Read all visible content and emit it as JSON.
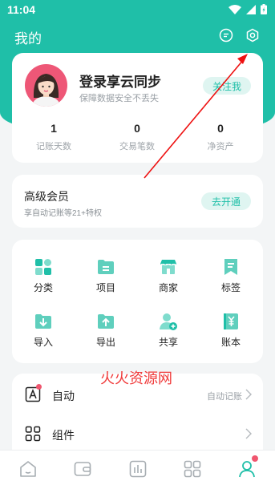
{
  "status_bar": {
    "time": "11:04"
  },
  "header": {
    "title": "我的"
  },
  "profile": {
    "title": "登录享云同步",
    "subtitle": "保障数据安全不丢失",
    "follow_label": "关注我",
    "stats": [
      {
        "value": "1",
        "label": "记账天数"
      },
      {
        "value": "0",
        "label": "交易笔数"
      },
      {
        "value": "0",
        "label": "净资产"
      }
    ]
  },
  "vip": {
    "title": "高级会员",
    "subtitle": "享自动记账等21+特权",
    "button": "去开通"
  },
  "grid": {
    "items": [
      {
        "label": "分类",
        "icon": "category-icon"
      },
      {
        "label": "项目",
        "icon": "project-folder-icon"
      },
      {
        "label": "商家",
        "icon": "store-icon"
      },
      {
        "label": "标签",
        "icon": "tag-icon"
      },
      {
        "label": "导入",
        "icon": "import-icon"
      },
      {
        "label": "导出",
        "icon": "export-icon"
      },
      {
        "label": "共享",
        "icon": "share-user-icon"
      },
      {
        "label": "账本",
        "icon": "ledger-icon"
      }
    ]
  },
  "list": {
    "items": [
      {
        "label": "自动",
        "value": "自动记账",
        "icon": "auto-a-icon"
      },
      {
        "label": "组件",
        "value": "",
        "icon": "widget-grid-icon"
      }
    ]
  },
  "watermark": "火火资源网",
  "colors": {
    "accent": "#1fbfa8",
    "accent_light": "#dff5f1",
    "badge": "#f0566f",
    "watermark": "#f03a3a"
  },
  "tabs": [
    {
      "name": "home",
      "icon": "home-icon"
    },
    {
      "name": "wallet",
      "icon": "wallet-icon"
    },
    {
      "name": "stats",
      "icon": "chart-icon"
    },
    {
      "name": "apps",
      "icon": "apps-grid-icon"
    },
    {
      "name": "me",
      "icon": "user-icon"
    }
  ]
}
